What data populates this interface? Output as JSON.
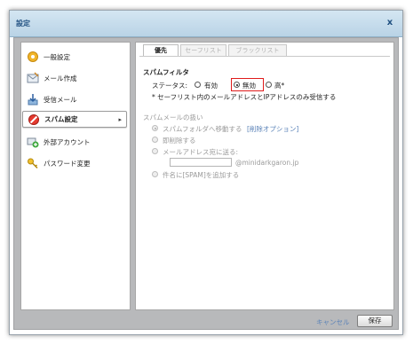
{
  "window": {
    "title": "設定",
    "close_symbol": "x"
  },
  "sidebar": {
    "items": [
      {
        "label": "一般設定",
        "icon": "gear-icon"
      },
      {
        "label": "メール作成",
        "icon": "compose-icon"
      },
      {
        "label": "受信メール",
        "icon": "inbox-download-icon"
      },
      {
        "label": "スパム設定",
        "icon": "no-entry-icon",
        "active": true,
        "arrow": "▸"
      },
      {
        "label": "外部アカウント",
        "icon": "add-account-icon"
      },
      {
        "label": "パスワード変更",
        "icon": "key-icon"
      }
    ]
  },
  "tabs": [
    {
      "label": "優先",
      "active": true
    },
    {
      "label": "セーフリスト",
      "active": false
    },
    {
      "label": "ブラックリスト",
      "active": false
    }
  ],
  "spam_filter": {
    "heading": "スパムフィルタ",
    "status_label": "ステータス:",
    "options": [
      {
        "label": "有効",
        "selected": false
      },
      {
        "label": "無効",
        "selected": true
      },
      {
        "label": "高*",
        "selected": false
      }
    ],
    "note": "* セーフリスト内のメールアドレスとIPアドレスのみ受信する"
  },
  "spam_handling": {
    "heading": "スパムメールの扱い",
    "move_label": "スパムフォルダへ移動する",
    "delete_option_link": "[削除オプション]",
    "delete_now_label": "即削除する",
    "forward_label": "メールアドレス宛に送る:",
    "forward_domain": "@minidarkgaron.jp",
    "prefix_label": "件名に[SPAM]を追加する"
  },
  "footer": {
    "cancel_label": "キャンセル",
    "save_label": "保存"
  }
}
